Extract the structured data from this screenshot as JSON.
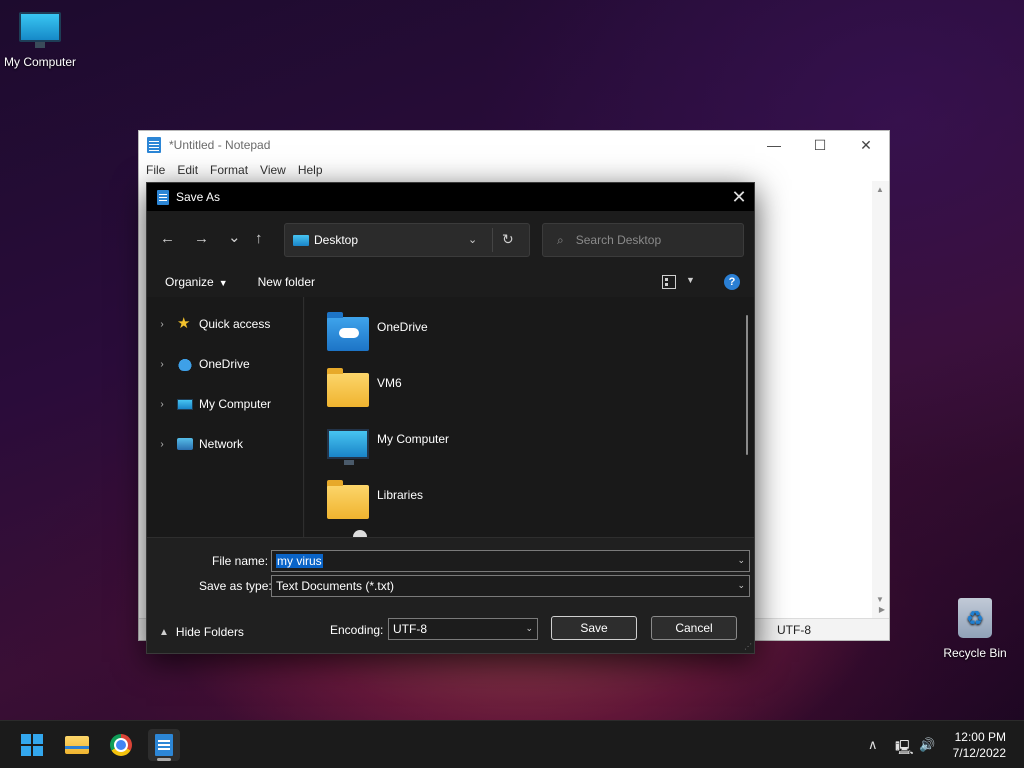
{
  "desktop": {
    "my_computer": "My Computer",
    "recycle_bin": "Recycle Bin"
  },
  "notepad": {
    "title": "*Untitled - Notepad",
    "menu": [
      "File",
      "Edit",
      "Format",
      "View",
      "Help"
    ],
    "encoding_status": "UTF-8",
    "controls": {
      "minimize": "—",
      "maximize": "☐",
      "close": "✕"
    }
  },
  "dialog": {
    "title": "Save As",
    "close": "✕",
    "nav": {
      "back": "←",
      "forward": "→",
      "recent": "⌄",
      "up": "↑"
    },
    "address": "Desktop",
    "search_placeholder": "Search Desktop",
    "toolbar": {
      "organize": "Organize",
      "new_folder": "New folder",
      "help": "?"
    },
    "tree": [
      {
        "label": "Quick access",
        "icon": "star-icon"
      },
      {
        "label": "OneDrive",
        "icon": "cloud-icon"
      },
      {
        "label": "My Computer",
        "icon": "monitor-icon"
      },
      {
        "label": "Network",
        "icon": "network-icon"
      }
    ],
    "items": [
      {
        "name": "OneDrive",
        "icon": "onedrive-folder-icon"
      },
      {
        "name": "VM6",
        "icon": "folder-icon"
      },
      {
        "name": "My Computer",
        "icon": "monitor-icon"
      },
      {
        "name": "Libraries",
        "icon": "folder-icon"
      }
    ],
    "file_name_label": "File name:",
    "file_name": "my virus",
    "save_type_label": "Save as type:",
    "save_type": "Text Documents (*.txt)",
    "hide_folders": "Hide Folders",
    "encoding_label": "Encoding:",
    "encoding": "UTF-8",
    "save": "Save",
    "cancel": "Cancel"
  },
  "taskbar": {
    "time": "12:00 PM",
    "date": "7/12/2022"
  },
  "colors": {
    "dialog_bg": "#1c1c1c",
    "selection": "#0a64c8",
    "accent": "#33a7ee"
  }
}
